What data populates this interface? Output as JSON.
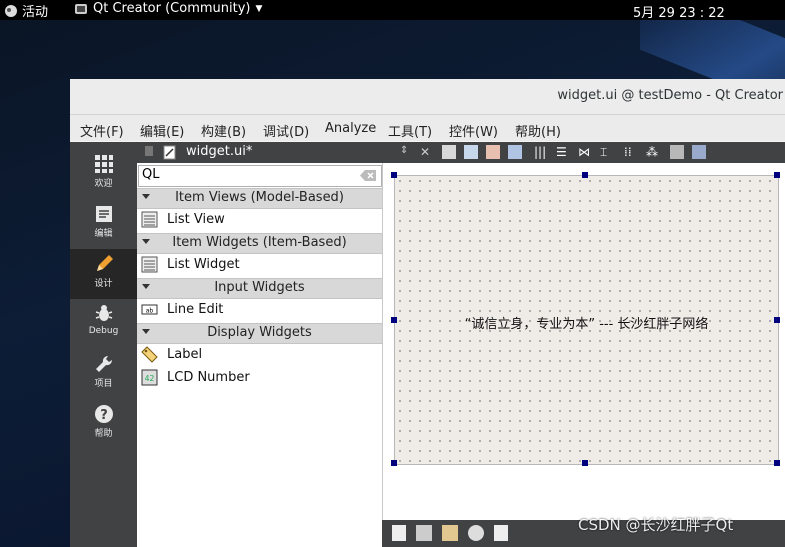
{
  "topbar": {
    "activities": "活动",
    "app_menu": "Qt Creator (Community)",
    "clock": "5月 29  23 : 22"
  },
  "window": {
    "title": "widget.ui @ testDemo - Qt Creator"
  },
  "menu": [
    "文件(F)",
    "编辑(E)",
    "构建(B)",
    "调试(D)",
    "Analyze",
    "工具(T)",
    "控件(W)",
    "帮助(H)"
  ],
  "modes": [
    {
      "label": "欢迎",
      "icon": "grid-icon"
    },
    {
      "label": "编辑",
      "icon": "document-icon"
    },
    {
      "label": "设计",
      "icon": "pencil-icon",
      "active": true
    },
    {
      "label": "Debug",
      "icon": "bug-icon"
    },
    {
      "label": "项目",
      "icon": "wrench-icon"
    },
    {
      "label": "帮助",
      "icon": "help-icon"
    }
  ],
  "doc_tab": "widget.ui*",
  "filter": {
    "value": "QL"
  },
  "widget_box": {
    "categories": [
      {
        "name": "Item Views (Model-Based)",
        "items": [
          {
            "label": "List View",
            "icon": "list-view-icon"
          }
        ]
      },
      {
        "name": "Item Widgets (Item-Based)",
        "items": [
          {
            "label": "List Widget",
            "icon": "list-widget-icon"
          }
        ]
      },
      {
        "name": "Input Widgets",
        "items": [
          {
            "label": "Line Edit",
            "icon": "line-edit-icon"
          }
        ]
      },
      {
        "name": "Display Widgets",
        "items": [
          {
            "label": "Label",
            "icon": "label-tag-icon"
          },
          {
            "label": "LCD Number",
            "icon": "lcd-number-icon"
          }
        ]
      }
    ]
  },
  "form": {
    "label_text": "“诚信立身，专业为本” --- 长沙红胖子网络"
  },
  "watermark": "CSDN @长沙红胖子Qt"
}
